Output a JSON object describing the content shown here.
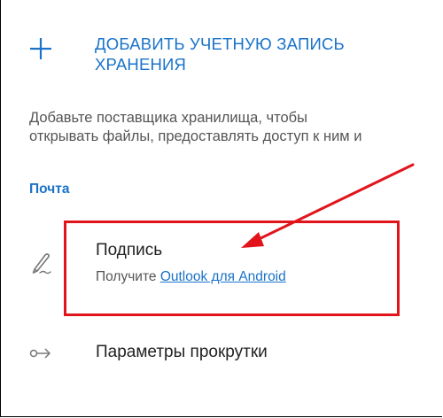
{
  "add_storage": {
    "icon": "plus-icon",
    "label_line1": "ДОБАВИТЬ УЧЕТНУЮ ЗАПИСЬ",
    "label_line2": "ХРАНЕНИЯ"
  },
  "description": {
    "line1": "Добавьте поставщика хранилища, чтобы",
    "line2": "открывать файлы, предоставлять доступ к ним и"
  },
  "mail_section": {
    "header": "Почта",
    "signature": {
      "icon": "signature-pen-icon",
      "title": "Подпись",
      "subtitle_prefix": "Получите ",
      "subtitle_link": "Outlook для Android"
    },
    "scroll_settings": {
      "icon": "swipe-arrow-icon",
      "label": "Параметры прокрутки"
    }
  },
  "annotation": {
    "color": "#e2141b",
    "type": "arrow-and-box"
  },
  "colors": {
    "accent": "#1a73c9",
    "highlight": "#e2141b"
  }
}
